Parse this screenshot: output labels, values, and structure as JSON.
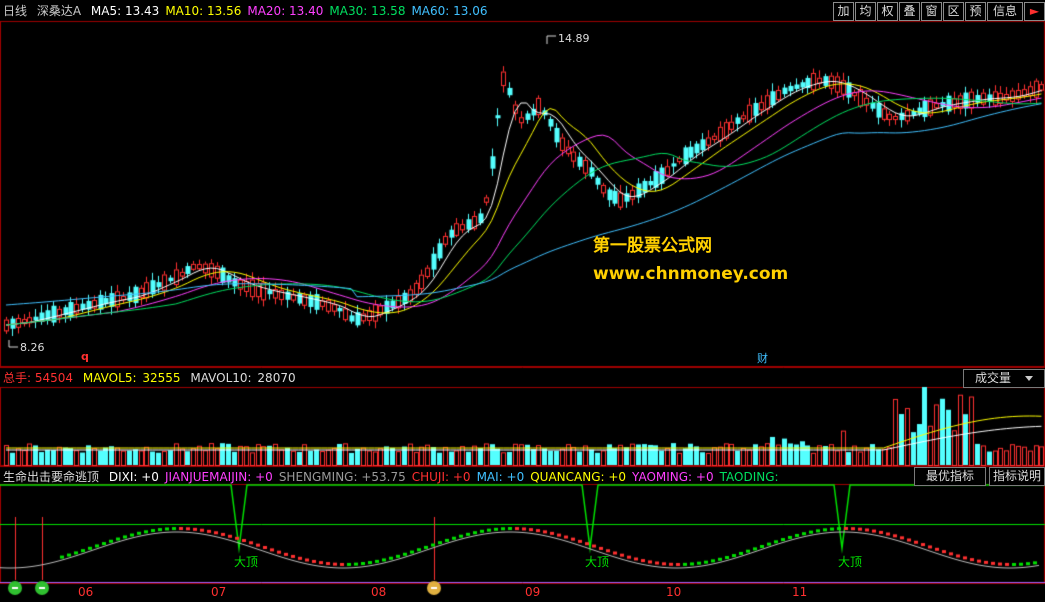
{
  "main_header": {
    "period": "日线",
    "stock": "深桑达A",
    "ma": [
      {
        "label": "MA5:",
        "value": "13.43",
        "color": "#ffffff"
      },
      {
        "label": "MA10:",
        "value": "13.56",
        "color": "#ffff00"
      },
      {
        "label": "MA20:",
        "value": "13.40",
        "color": "#ff40ff"
      },
      {
        "label": "MA30:",
        "value": "13.58",
        "color": "#00e060"
      },
      {
        "label": "MA60:",
        "value": "13.06",
        "color": "#40c0ff"
      }
    ]
  },
  "toolbar": [
    "加",
    "均",
    "权",
    "叠",
    "窗",
    "区",
    "预",
    "信息"
  ],
  "toolbar_last_icon": "play-arrow-icon",
  "price_annotations": {
    "high": "14.89",
    "low": "8.26",
    "q_marker": "q",
    "cai_marker": "财"
  },
  "watermark": {
    "line1": "第一股票公式网",
    "line2": "www.chnmoney.com"
  },
  "vol_header": {
    "label": "总手:",
    "value": "54504",
    "mavol5_label": "MAVOL5:",
    "mavol5": "32555",
    "mavol10_label": "MAVOL10:",
    "mavol10": "28070",
    "dropdown": "成交量"
  },
  "ind_header": {
    "name": "生命出击要命逃顶",
    "params": [
      {
        "label": "DIXI:",
        "value": "+0",
        "color": "#ffffff"
      },
      {
        "label": "JIANJUEMAIJIN:",
        "value": "+0",
        "color": "#ff40ff"
      },
      {
        "label": "SHENGMING:",
        "value": "+53.75",
        "color": "#9a9a9a"
      },
      {
        "label": "CHUJI:",
        "value": "+0",
        "color": "#ff3030"
      },
      {
        "label": "MAI:",
        "value": "+0",
        "color": "#40c0ff"
      },
      {
        "label": "QUANCANG:",
        "value": "+0",
        "color": "#ffff00"
      },
      {
        "label": "YAOMING:",
        "value": "+0",
        "color": "#ff40ff"
      },
      {
        "label": "TAODING:",
        "value": "",
        "color": "#00e060"
      }
    ],
    "btn_best": "最优指标",
    "btn_explain": "指标说明"
  },
  "top_markers": [
    "大顶",
    "大顶",
    "大顶"
  ],
  "x_labels": [
    "06",
    "07",
    "08",
    "09",
    "10",
    "11"
  ],
  "colors": {
    "up": "#ff3030",
    "down": "#54ffff",
    "grid": "#a00000",
    "signal": "#00e000"
  },
  "chart_data": {
    "type": "candlestick",
    "series_note": "daily candles with MA5/MA10/MA20/MA30/MA60, volume bars, indicator",
    "price_high": 14.89,
    "price_low": 8.26
  }
}
